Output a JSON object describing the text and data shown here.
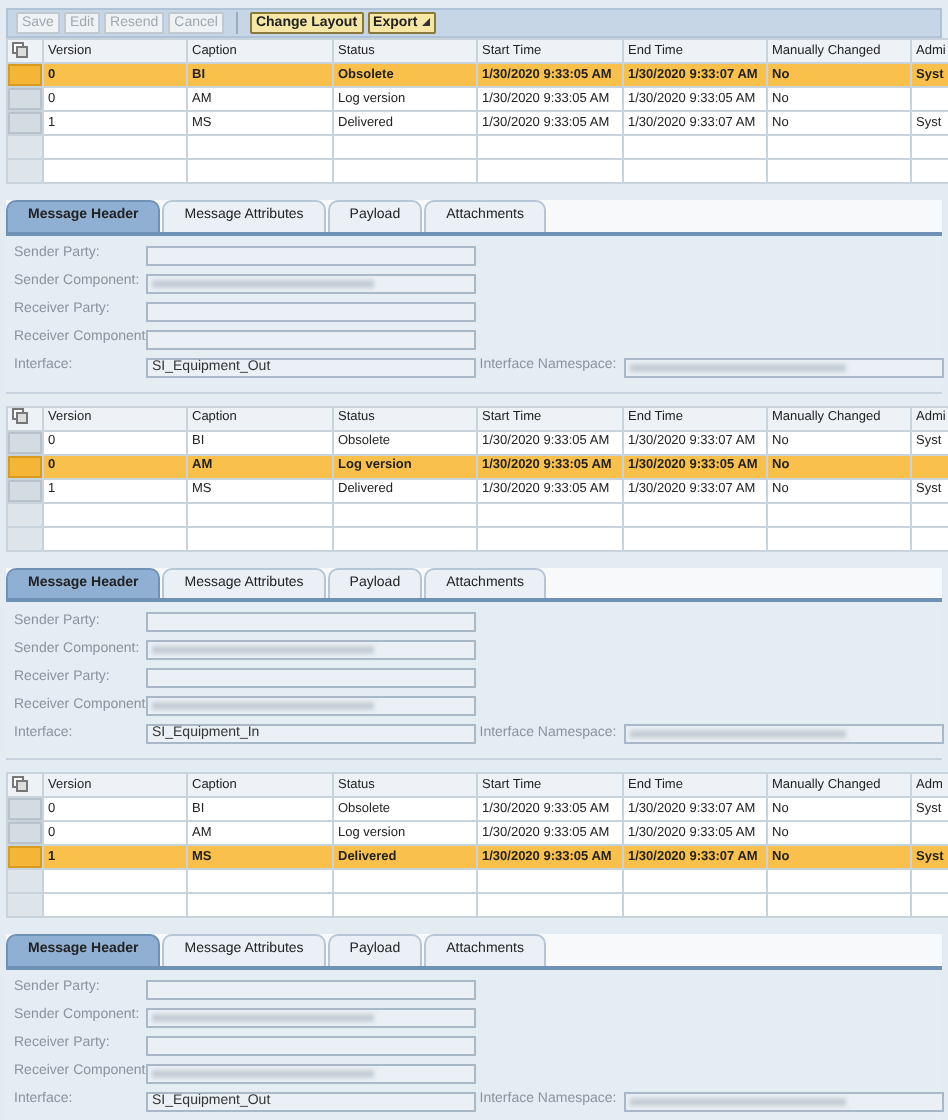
{
  "toolbar": {
    "buttons": [
      {
        "label": "Save",
        "disabled": true
      },
      {
        "label": "Edit",
        "disabled": true
      },
      {
        "label": "Resend",
        "disabled": true
      },
      {
        "label": "Cancel",
        "disabled": true
      },
      {
        "label": "Change Layout",
        "disabled": false
      },
      {
        "label": "Export",
        "disabled": false,
        "menu": true
      }
    ]
  },
  "panels": [
    {
      "table": {
        "columns": [
          "Version",
          "Caption",
          "Status",
          "Start Time",
          "End Time",
          "Manually Changed",
          "Admi"
        ],
        "rows": [
          {
            "selected": true,
            "cells": [
              "0",
              "BI",
              "Obsolete",
              "1/30/2020 9:33:05 AM",
              "1/30/2020 9:33:07 AM",
              "No",
              "Syst"
            ]
          },
          {
            "selected": false,
            "cells": [
              "0",
              "AM",
              "Log version",
              "1/30/2020 9:33:05 AM",
              "1/30/2020 9:33:05 AM",
              "No",
              null
            ]
          },
          {
            "selected": false,
            "cells": [
              "1",
              "MS",
              "Delivered",
              "1/30/2020 9:33:05 AM",
              "1/30/2020 9:33:07 AM",
              "No",
              "Syst"
            ]
          }
        ]
      },
      "tabs": [
        {
          "label": "Message Header",
          "selected": true
        },
        {
          "label": "Message Attributes",
          "selected": false
        },
        {
          "label": "Payload",
          "selected": false
        },
        {
          "label": "Attachments",
          "selected": false
        }
      ],
      "form": [
        [
          {
            "label": "Sender Party:"
          }
        ],
        [
          {
            "label": "Sender Component:",
            "redacted": true
          }
        ],
        [
          {
            "label": "Receiver Party:"
          }
        ],
        [
          {
            "label": "Receiver Component:"
          }
        ],
        [
          {
            "label": "Interface:",
            "value": "SI_Equipment_Out"
          },
          {
            "label": "Interface Namespace:",
            "redacted": true
          }
        ]
      ]
    },
    {
      "table": {
        "columns": [
          "Version",
          "Caption",
          "Status",
          "Start Time",
          "End Time",
          "Manually Changed",
          "Admi"
        ],
        "rows": [
          {
            "selected": false,
            "cells": [
              "0",
              "BI",
              "Obsolete",
              "1/30/2020 9:33:05 AM",
              "1/30/2020 9:33:07 AM",
              "No",
              "Syst"
            ]
          },
          {
            "selected": true,
            "cells": [
              "0",
              "AM",
              "Log version",
              "1/30/2020 9:33:05 AM",
              "1/30/2020 9:33:05 AM",
              "No",
              null
            ]
          },
          {
            "selected": false,
            "cells": [
              "1",
              "MS",
              "Delivered",
              "1/30/2020 9:33:05 AM",
              "1/30/2020 9:33:07 AM",
              "No",
              "Syst"
            ]
          }
        ]
      },
      "tabs": [
        {
          "label": "Message Header",
          "selected": true
        },
        {
          "label": "Message Attributes",
          "selected": false
        },
        {
          "label": "Payload",
          "selected": false
        },
        {
          "label": "Attachments",
          "selected": false
        }
      ],
      "form": [
        [
          {
            "label": "Sender Party:"
          }
        ],
        [
          {
            "label": "Sender Component:",
            "redacted": true
          }
        ],
        [
          {
            "label": "Receiver Party:"
          }
        ],
        [
          {
            "label": "Receiver Component:",
            "redacted": true
          }
        ],
        [
          {
            "label": "Interface:",
            "value": "SI_Equipment_In"
          },
          {
            "label": "Interface Namespace:",
            "redacted": true
          }
        ]
      ]
    },
    {
      "table": {
        "columns": [
          "Version",
          "Caption",
          "Status",
          "Start Time",
          "End Time",
          "Manually Changed",
          "Adm"
        ],
        "rows": [
          {
            "selected": false,
            "cells": [
              "0",
              "BI",
              "Obsolete",
              "1/30/2020 9:33:05 AM",
              "1/30/2020 9:33:07 AM",
              "No",
              "Syst"
            ]
          },
          {
            "selected": false,
            "cells": [
              "0",
              "AM",
              "Log version",
              "1/30/2020 9:33:05 AM",
              "1/30/2020 9:33:05 AM",
              "No",
              null
            ]
          },
          {
            "selected": true,
            "cells": [
              "1",
              "MS",
              "Delivered",
              "1/30/2020 9:33:05 AM",
              "1/30/2020 9:33:07 AM",
              "No",
              "Syst"
            ]
          }
        ]
      },
      "tabs": [
        {
          "label": "Message Header",
          "selected": true
        },
        {
          "label": "Message Attributes",
          "selected": false
        },
        {
          "label": "Payload",
          "selected": false
        },
        {
          "label": "Attachments",
          "selected": false
        }
      ],
      "form": [
        [
          {
            "label": "Sender Party:"
          }
        ],
        [
          {
            "label": "Sender Component:",
            "redacted": true
          }
        ],
        [
          {
            "label": "Receiver Party:"
          }
        ],
        [
          {
            "label": "Receiver Component:",
            "redacted": true
          }
        ],
        [
          {
            "label": "Interface:",
            "value": "SI_Equipment_Out"
          },
          {
            "label": "Interface Namespace:",
            "redacted": true
          }
        ]
      ]
    }
  ]
}
